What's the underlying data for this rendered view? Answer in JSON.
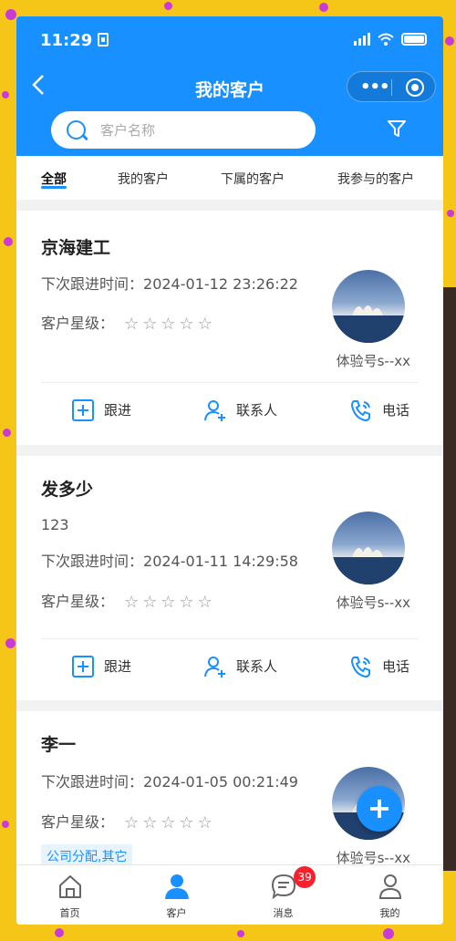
{
  "status_bar": {
    "time": "11:29"
  },
  "header": {
    "title": "我的客户",
    "capsule_menu": "•••"
  },
  "search": {
    "placeholder": "客户名称"
  },
  "tabs": [
    {
      "label": "全部",
      "active": true
    },
    {
      "label": "我的客户",
      "active": false
    },
    {
      "label": "下属的客户",
      "active": false
    },
    {
      "label": "我参与的客户",
      "active": false
    }
  ],
  "customers": [
    {
      "name": "京海建工",
      "next_follow_label": "下次跟进时间：",
      "next_follow_time": "2024-01-12 23:26:22",
      "rating_label": "客户星级：",
      "stars": 0,
      "owner": "体验号s--xx"
    },
    {
      "name": "发多少",
      "extra_line": "123",
      "next_follow_label": "下次跟进时间：",
      "next_follow_time": "2024-01-11 14:29:58",
      "rating_label": "客户星级：",
      "stars": 0,
      "owner": "体验号s--xx"
    },
    {
      "name": "李一",
      "next_follow_label": "下次跟进时间：",
      "next_follow_time": "2024-01-05 00:21:49",
      "rating_label": "客户星级：",
      "stars": 0,
      "tag": "公司分配,其它",
      "owner": "体验号s--xx"
    }
  ],
  "actions": {
    "follow": "跟进",
    "contact": "联系人",
    "phone": "电话"
  },
  "fab": {
    "label": "+"
  },
  "tabbar": [
    {
      "label": "首页",
      "icon": "home-icon"
    },
    {
      "label": "客户",
      "icon": "customer-icon",
      "active": true
    },
    {
      "label": "消息",
      "icon": "message-icon",
      "badge": "39"
    },
    {
      "label": "我的",
      "icon": "profile-icon"
    }
  ],
  "colors": {
    "primary": "#1890ff",
    "badge": "#f5222d",
    "tag_bg": "#e6f4ff"
  }
}
